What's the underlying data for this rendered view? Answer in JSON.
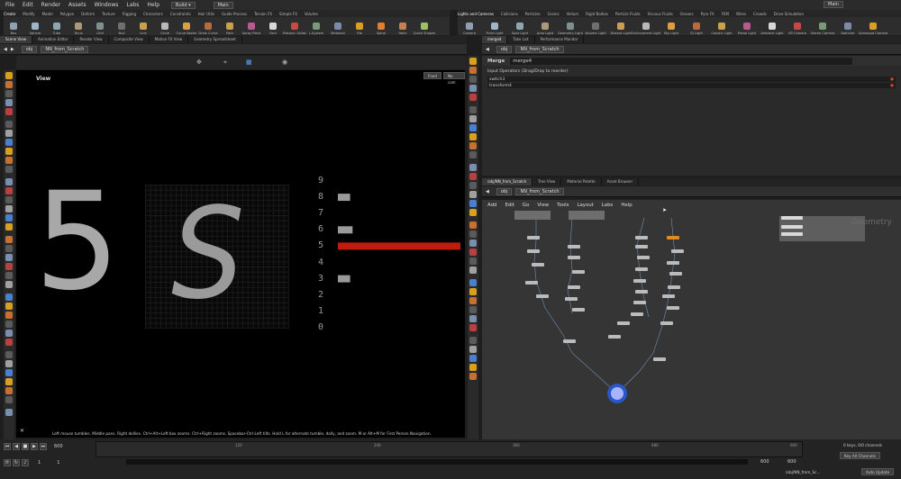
{
  "menubar": {
    "items": [
      "File",
      "Edit",
      "Render",
      "Assets",
      "Windows",
      "Labs",
      "Help"
    ],
    "desktop": "Build",
    "take": "Main",
    "right_desktop": "Main"
  },
  "shelf_tabs_left": [
    "Create",
    "Modify",
    "Model",
    "Polygon",
    "Deform",
    "Texture",
    "Rigging",
    "Characters",
    "Constraints",
    "Hair Utils",
    "Guide Process",
    "Terrain FX",
    "Simple FX",
    "Volume"
  ],
  "shelf_tabs_right": [
    "Lights and Cameras",
    "Collisions",
    "Particles",
    "Grains",
    "Vellum",
    "Rigid Bodies",
    "Particle Fluids",
    "Viscous Fluids",
    "Oceans",
    "Pyro FX",
    "FEM",
    "Wires",
    "Crowds",
    "Drive Simulation"
  ],
  "shelf_tools_left": [
    "Box",
    "Sphere",
    "Tube",
    "Torus",
    "Grid",
    "Null",
    "Line",
    "Circle",
    "Curve Bezier",
    "Draw Curve",
    "Path",
    "Spray Paint",
    "Font",
    "Platonic Solids",
    "L-System",
    "Metaball",
    "File",
    "Spiral",
    "Helix",
    "Quick Shapes"
  ],
  "shelf_tools_right": [
    "Camera",
    "Point Light",
    "Spot Light",
    "Area Light",
    "Geometry Light",
    "Volume Light",
    "Distant Light",
    "Environment Light",
    "Sky Light",
    "GI Light",
    "Caustic Light",
    "Portal Light",
    "Ambient Light",
    "VR Camera",
    "Stereo Camera",
    "Switcher",
    "Gamepad Camera"
  ],
  "left_pane_tabs": [
    "Scene View",
    "Animation Editor",
    "Render View",
    "Composite View",
    "Motion FX View",
    "Geometry Spreadsheet"
  ],
  "left_path": "obj",
  "left_node": "NN_from_Scratch",
  "viewport": {
    "title": "View",
    "camera_persp": "Front",
    "camera_menu": "No cam",
    "big_digit": "5",
    "pixel_digit": "S",
    "labels": [
      "9",
      "8",
      "7",
      "6",
      "5",
      "4",
      "3",
      "2",
      "1",
      "0"
    ],
    "activations": [
      0,
      0.1,
      0,
      0.12,
      1.0,
      0,
      0.1,
      0,
      0,
      0
    ],
    "status_text": "Left mouse tumbles. Middle pans. Right dollies. Ctrl+Alt+Left box zooms. Ctrl+Right zooms. Spacebar-Ctrl-Left tilts. Hold L for alternate tumble, dolly, and zoom. M or Alt+M for First Person Navigation."
  },
  "params": {
    "tabs": [
      "merge4",
      "Take List",
      "Performance Monitor"
    ],
    "path": "obj",
    "node": "NN_from_Scratch",
    "node_type": "Merge",
    "node_name": "merge4",
    "section": "Input Operators (Drag/Drop to reorder)",
    "inputs": [
      "switch3",
      "transform4"
    ]
  },
  "network": {
    "tabs": [
      "/obj/NN_from_Scratch",
      "Tree View",
      "Material Palette",
      "Asset Browser"
    ],
    "path": "obj",
    "node": "NN_from_Scratch",
    "menu": [
      "Add",
      "Edit",
      "Go",
      "View",
      "Tools",
      "Layout",
      "Labs",
      "Help"
    ],
    "context_label": "Geometry"
  },
  "timeline": {
    "frame": "600",
    "ticks": [
      "120",
      "240",
      "360",
      "480",
      "600"
    ],
    "start": "1",
    "current": "1",
    "end": "600",
    "end2": "600",
    "keys_label": "0 keys, 0/0 channels",
    "key_all": "Key All Channels",
    "path_label": "/obj/NN_from_Sc...",
    "auto_update": "Auto Update"
  },
  "colors": {
    "accent_red": "#c01b0b",
    "pixel_fill": "#9a9a9a",
    "selected_node": "#3a6fd8"
  }
}
